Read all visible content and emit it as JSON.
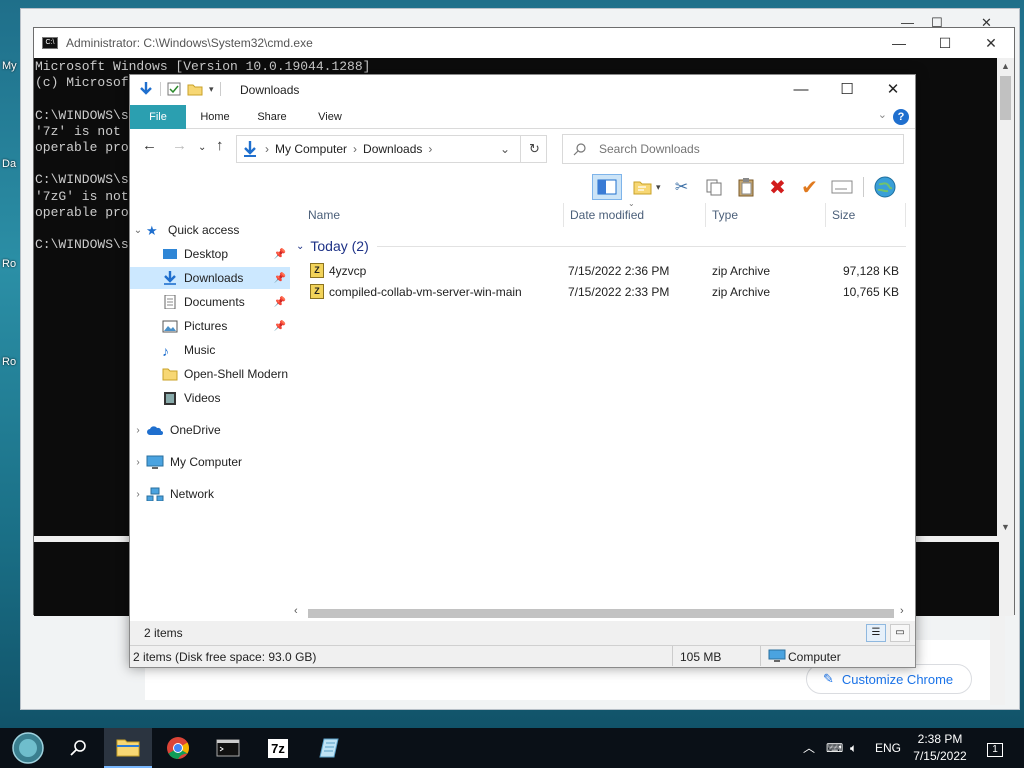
{
  "desktop": {
    "labels": [
      "My",
      "Da",
      "Ro",
      "Ro"
    ]
  },
  "chrome": {
    "customize_label": "Customize Chrome"
  },
  "cmd": {
    "title": "Administrator: C:\\Windows\\System32\\cmd.exe",
    "lines": [
      "Microsoft Windows [Version 10.0.19044.1288]",
      "(c) Microsof",
      "",
      "C:\\WINDOWS\\s",
      "'7z' is not",
      "operable pro",
      "",
      "C:\\WINDOWS\\s",
      "'7zG' is not",
      "operable pro",
      "",
      "C:\\WINDOWS\\s"
    ]
  },
  "explorer": {
    "title": "Downloads",
    "ribbon_tabs": [
      "File",
      "Home",
      "Share",
      "View"
    ],
    "breadcrumb": [
      "My Computer",
      "Downloads"
    ],
    "search_placeholder": "Search Downloads",
    "nav": {
      "quick_access": "Quick access",
      "items": [
        "Desktop",
        "Downloads",
        "Documents",
        "Pictures",
        "Music",
        "Open-Shell Modern",
        "Videos"
      ],
      "onedrive": "OneDrive",
      "my_computer": "My Computer",
      "network": "Network"
    },
    "columns": [
      "Name",
      "Date modified",
      "Type",
      "Size"
    ],
    "group_label": "Today (2)",
    "files": [
      {
        "name": "4yzvcp",
        "date": "7/15/2022 2:36 PM",
        "type": "zip Archive",
        "size": "97,128 KB"
      },
      {
        "name": "compiled-collab-vm-server-win-main",
        "date": "7/15/2022 2:33 PM",
        "type": "zip Archive",
        "size": "10,765 KB"
      }
    ],
    "status_items": "2 items",
    "status_detail": "2 items (Disk free space: 93.0 GB)",
    "status_size": "105 MB",
    "status_location": "Computer"
  },
  "taskbar": {
    "lang": "ENG",
    "time": "2:38 PM",
    "date": "7/15/2022",
    "notifications": "1",
    "seven_zip_label": "7z"
  }
}
